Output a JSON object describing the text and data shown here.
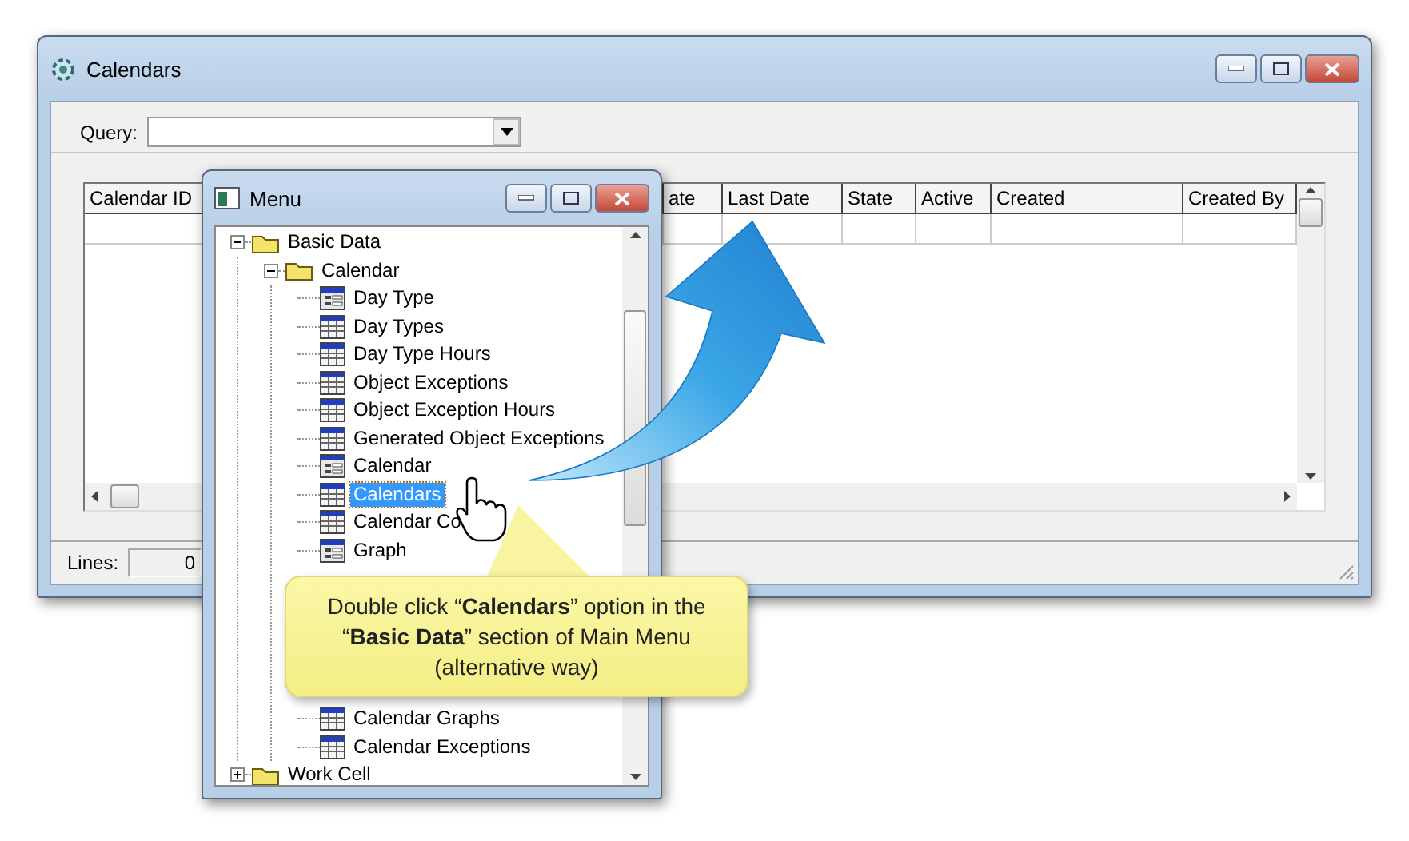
{
  "main_window": {
    "title": "Calendars",
    "query": {
      "label": "Query:"
    },
    "table": {
      "columns": [
        {
          "label": "Calendar ID"
        },
        {
          "label": "ate"
        },
        {
          "label": "Last Date"
        },
        {
          "label": "State"
        },
        {
          "label": "Active"
        },
        {
          "label": "Created"
        },
        {
          "label": "Created By"
        }
      ]
    },
    "status_bar": {
      "label": "Lines:",
      "value": "0"
    }
  },
  "menu_window": {
    "title": "Menu",
    "tree": [
      {
        "label": "Basic Data",
        "kind": "folder",
        "expanded": true,
        "selected": false,
        "children": [
          {
            "label": "Calendar",
            "kind": "folder",
            "expanded": true,
            "selected": false,
            "children": [
              {
                "label": "Day Type",
                "kind": "form",
                "selected": false
              },
              {
                "label": "Day Types",
                "kind": "grid",
                "selected": false
              },
              {
                "label": "Day Type Hours",
                "kind": "grid",
                "selected": false
              },
              {
                "label": "Object Exceptions",
                "kind": "grid",
                "selected": false
              },
              {
                "label": "Object Exception Hours",
                "kind": "grid",
                "selected": false
              },
              {
                "label": "Generated Object Exceptions",
                "kind": "grid",
                "selected": false
              },
              {
                "label": "Calendar",
                "kind": "form",
                "selected": false
              },
              {
                "label": "Calendars",
                "kind": "grid",
                "selected": true
              },
              {
                "label": "Calendar Co",
                "kind": "grid",
                "selected": false
              },
              {
                "label": "Graph",
                "kind": "form",
                "selected": false
              },
              {
                "label": "Calendar Graphs",
                "kind": "grid",
                "selected": false,
                "gap_before": true
              },
              {
                "label": "Calendar Exceptions",
                "kind": "grid",
                "selected": false
              }
            ]
          }
        ]
      },
      {
        "label": "Work Cell",
        "kind": "folder",
        "expanded": false,
        "selected": false
      }
    ]
  },
  "callout": {
    "text": "Double click “**Calendars**” option in the “**Basic Data**” section of Main Menu (alternative way)"
  }
}
